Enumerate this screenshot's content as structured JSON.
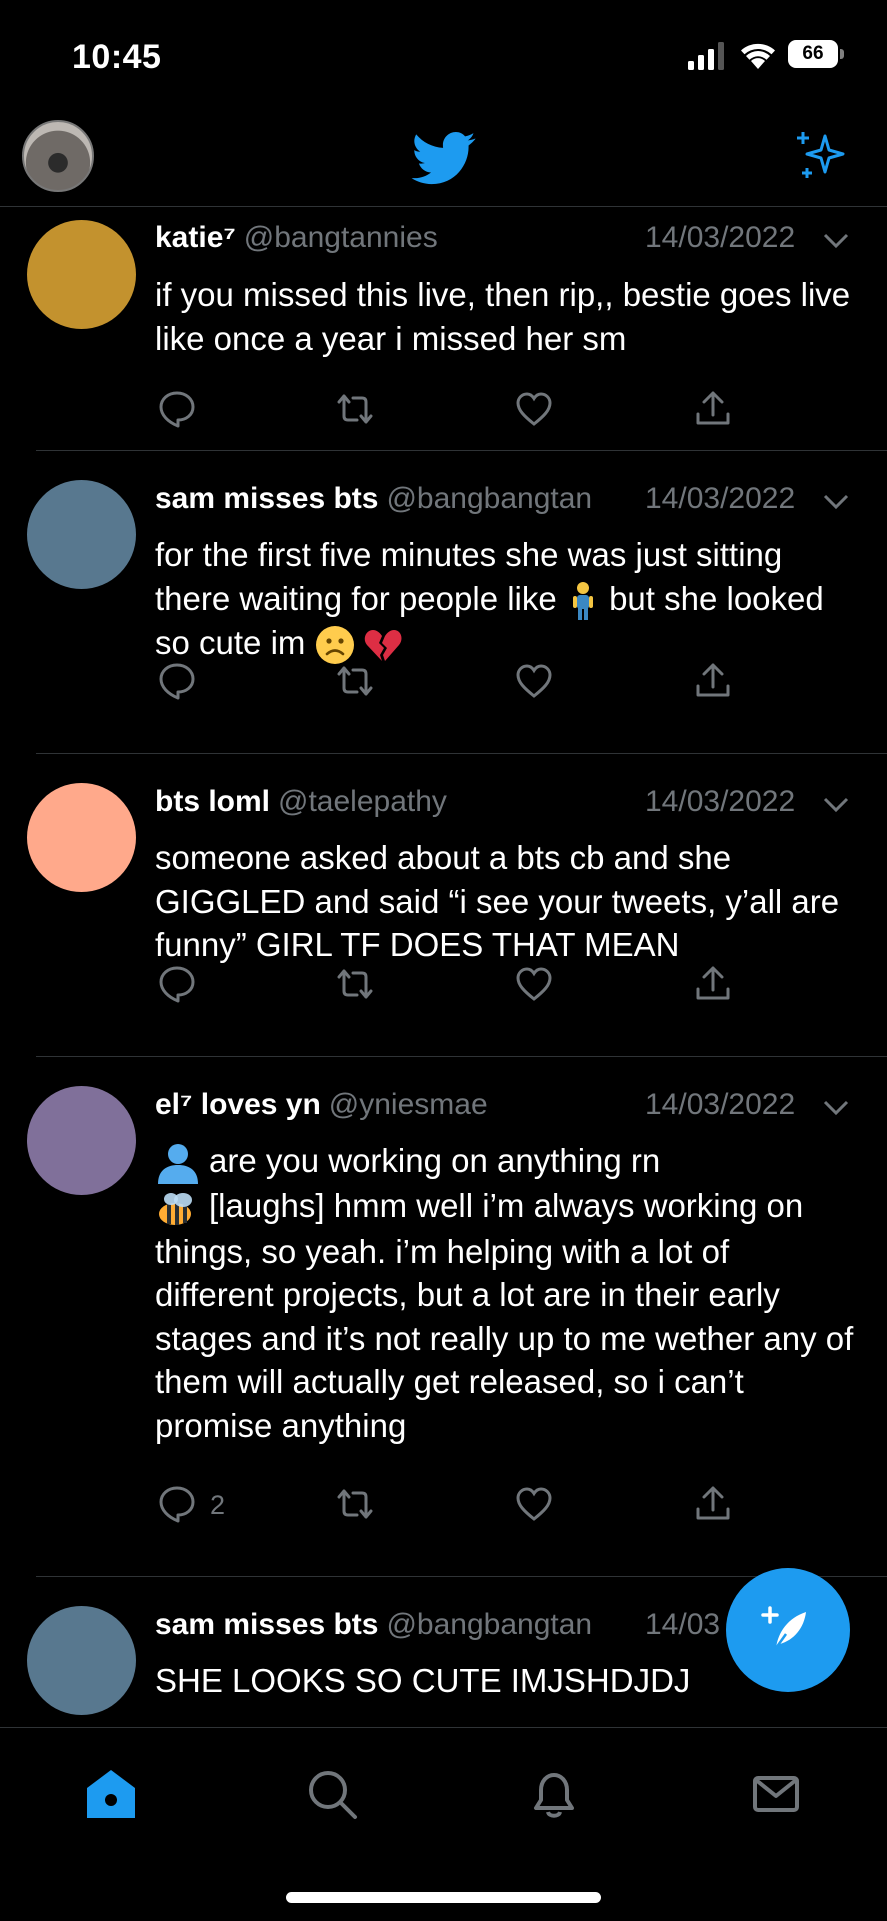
{
  "status_bar": {
    "time": "10:45",
    "battery": "66"
  },
  "header": {
    "logo_icon": "twitter-bird-icon",
    "sparkle_icon": "sparkle-icon",
    "accent": "#1d9bf0"
  },
  "tweets": [
    {
      "name": "katie⁷",
      "handle": "@bangtannies",
      "date": "14/03/2022",
      "avatar_color": "#c3922e",
      "text": "if you missed this live, then rip,, bestie goes live like once a year i missed her sm",
      "reply_count": ""
    },
    {
      "name": "sam misses bts",
      "handle": "@bangbangtan",
      "date": "14/03/2022",
      "avatar_color": "#58788f",
      "text_a": "for the first five minutes she was just sitting there waiting for people like ",
      "text_b": " but she looked so cute im ",
      "reply_count": ""
    },
    {
      "name": "bts loml",
      "handle": "@taelepathy",
      "date": "14/03/2022",
      "avatar_color": "#ffa98b",
      "text": "someone asked about a bts cb and she GIGGLED and said “i see your tweets, y’all are funny” GIRL TF DOES THAT MEAN",
      "reply_count": ""
    },
    {
      "name": "el⁷ loves yn",
      "handle": "@yniesmae",
      "date": "14/03/2022",
      "avatar_color": "#80709a",
      "text_q": "are you working on anything rn",
      "text_a": "[laughs] hmm well i’m always working on things, so yeah. i’m helping with a lot of different projects, but a lot are in their early stages and it’s not really up to me wether any of them will actually get released, so i can’t promise anything",
      "reply_count": "2"
    },
    {
      "name": "sam misses bts",
      "handle": "@bangbangtan",
      "date": "14/03",
      "avatar_color": "#58788f",
      "text": "SHE LOOKS SO CUTE IMJSHDJDJ"
    }
  ],
  "tab_bar": {
    "items": [
      "home-icon",
      "search-icon",
      "notifications-icon",
      "messages-icon"
    ],
    "active": "home-icon"
  }
}
